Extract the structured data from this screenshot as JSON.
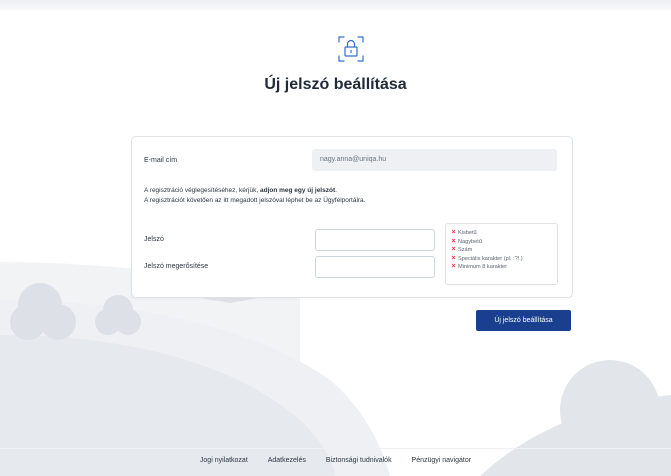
{
  "page": {
    "title": "Új jelszó beállítása"
  },
  "form": {
    "email_label": "E-mail cím",
    "email_value": "nagy.anna@uniqa.hu",
    "info_line1_pre": "A regisztráció véglegesítéséhez, kérjük, ",
    "info_line1_bold": "adjon meg egy új jelszót",
    "info_line1_post": ".",
    "info_line2": "A regisztrációt követően az itt megadott jelszóval léphet be az Ügyfélportálra.",
    "password_label": "Jelszó",
    "password_value": "",
    "confirm_label": "Jelszó megerősítése",
    "confirm_value": "",
    "rules": [
      {
        "text": "Kisbetű"
      },
      {
        "text": "Nagybetű"
      },
      {
        "text": "Szám"
      },
      {
        "text": "Speciális karakter (pl. :?!.)"
      },
      {
        "text": "Minimum 8 karakter"
      }
    ],
    "rule_fail_icon": "×",
    "submit_label": "Új jelszó beállítása"
  },
  "footer": {
    "links": [
      "Jogi nyilatkozat",
      "Adatkezelés",
      "Biztonsági tudnivalók",
      "Pénzügyi navigátor"
    ]
  },
  "colors": {
    "primary_button": "#1b3f8f",
    "error": "#d8333c",
    "icon": "#2f6fd0"
  },
  "icons": {
    "header": "padlock-icon",
    "rule_status": "cross-icon"
  }
}
